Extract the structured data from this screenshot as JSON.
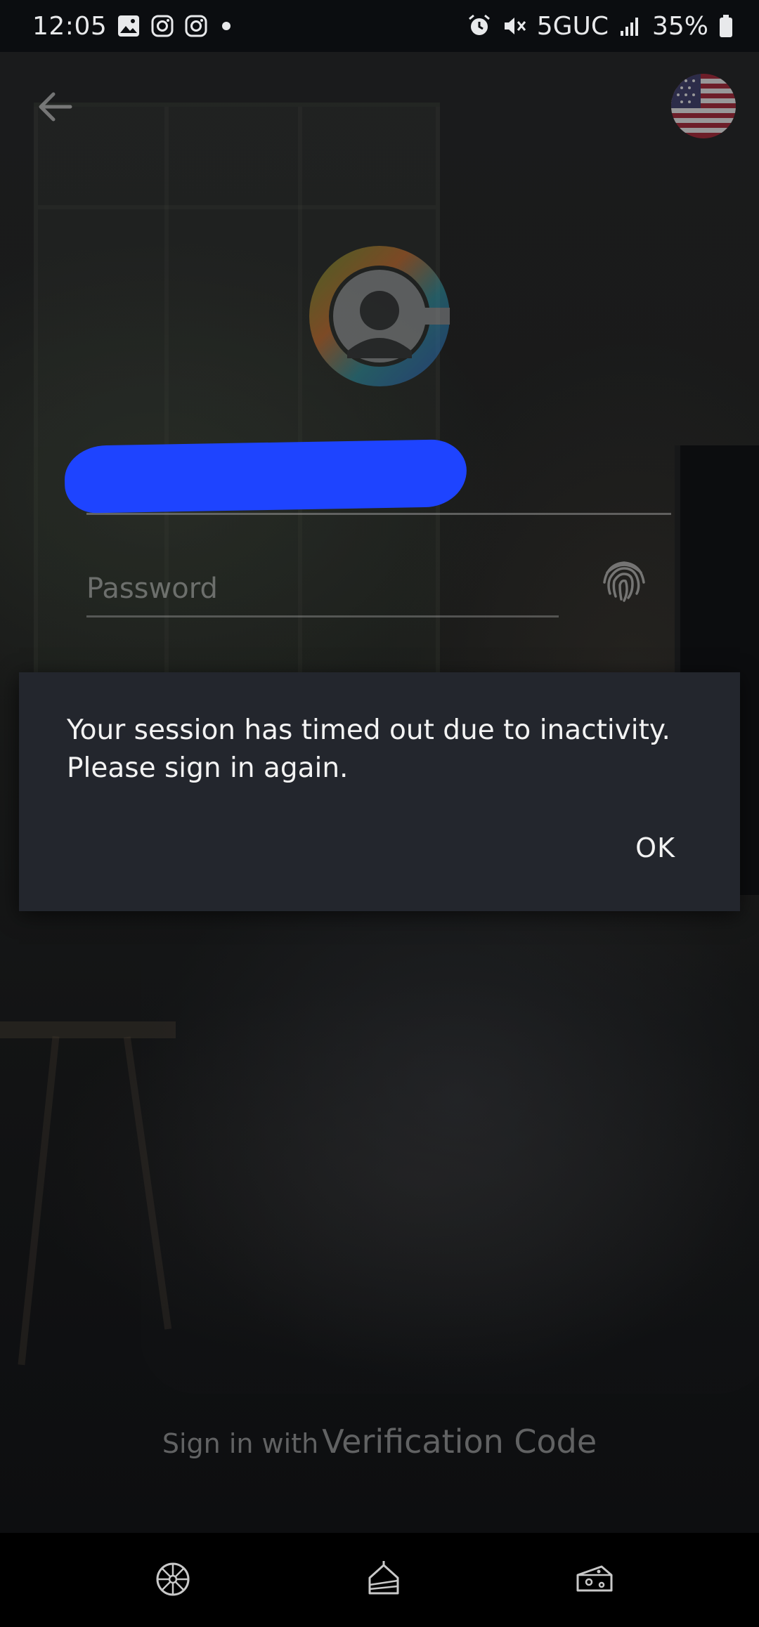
{
  "status_bar": {
    "time": "12:05",
    "network": "5GUC",
    "battery": "35%",
    "left_icons": [
      "gallery-icon",
      "instagram-icon",
      "instagram-icon",
      "dot-icon"
    ],
    "right_icons": [
      "alarm-icon",
      "mute-icon",
      "signal-icon",
      "battery-icon"
    ]
  },
  "header": {
    "back_icon": "arrow-left-icon",
    "language_flag": "us-flag-icon"
  },
  "login_form": {
    "username_value": "",
    "password_placeholder": "Password",
    "fingerprint_icon": "fingerprint-icon"
  },
  "dialog": {
    "message": "Your session has timed out due to inactivity.\nPlease sign in again.",
    "ok_label": "OK"
  },
  "footer": {
    "verification_prefix": "Sign in with",
    "verification_main": "Verification Code"
  },
  "bottom_nav": {
    "items": [
      "wheel-icon",
      "cake-slice-icon",
      "cheese-icon"
    ]
  },
  "colors": {
    "dialog_bg": "#23262d",
    "redaction": "#1e44ff",
    "status_bar_bg": "#0b0d10"
  }
}
